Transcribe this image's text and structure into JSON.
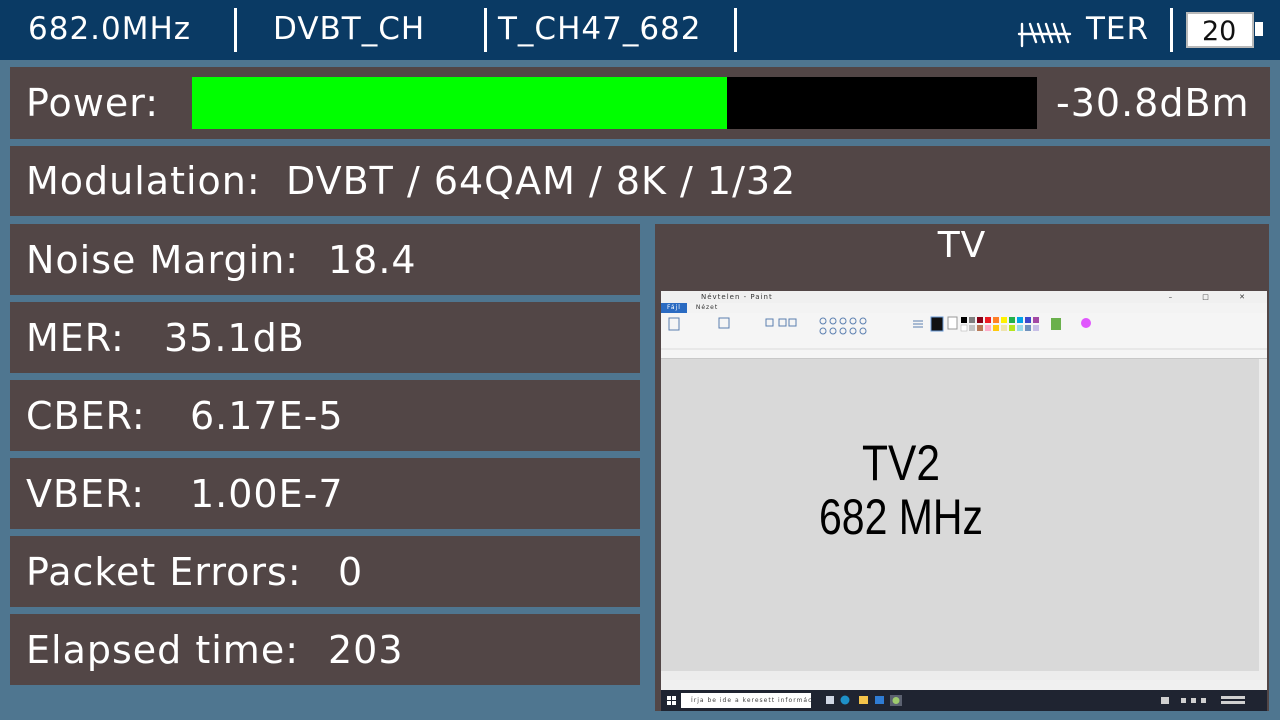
{
  "header": {
    "frequency": "682.0MHz",
    "channel_table": "DVBT_CH",
    "channel": "T_CH47_682",
    "band": "TER",
    "battery_level": "20"
  },
  "power": {
    "label": "Power:",
    "value": "-30.8dBm",
    "level_fraction": 0.633,
    "fill_color": "#00ff00"
  },
  "modulation": {
    "label": "Modulation:",
    "value": "DVBT / 64QAM / 8K / 1/32"
  },
  "measurements": [
    {
      "label": "Noise Margin:",
      "value": "18.4"
    },
    {
      "label": "MER:",
      "value": "35.1dB"
    },
    {
      "label": "CBER:",
      "value": "6.17E-5"
    },
    {
      "label": "VBER:",
      "value": "1.00E-7"
    },
    {
      "label": "Packet Errors:",
      "value": "0"
    },
    {
      "label": "Elapsed time:",
      "value": "203"
    }
  ],
  "tv": {
    "title": "TV",
    "preview": {
      "line1": "TV2",
      "line2": "682 MHz",
      "window_title": "Névtelen - Paint",
      "file_tab": "Fájl",
      "view_tab": "Nézet",
      "search_placeholder": "Írja be ide a keresett információt"
    }
  },
  "colors": {
    "background": "#4f7690",
    "header": "#0a3a64",
    "panel": "#524646",
    "bar_track": "#000000"
  }
}
